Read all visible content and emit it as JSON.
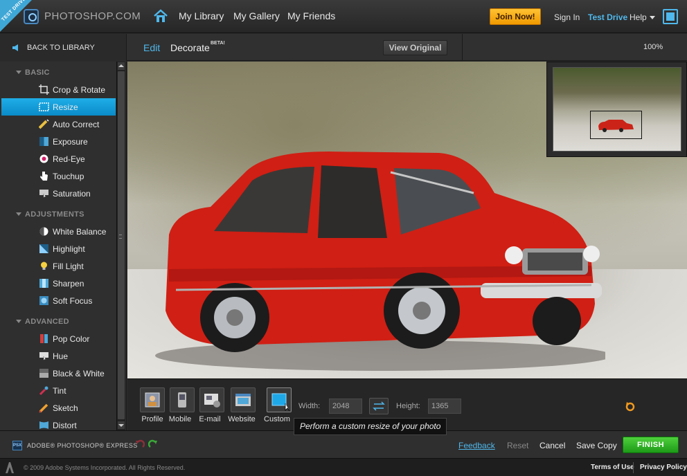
{
  "topbar": {
    "ribbon": "TEST DRIVE",
    "brand": "PHOTOSHOP.COM",
    "nav": [
      "My Library",
      "My Gallery",
      "My Friends"
    ],
    "join": "Join Now!",
    "sign_in": "Sign In",
    "test_drive": "Test Drive",
    "help": "Help",
    "accent_color": "#4fb8ec",
    "join_color": "#f5a800"
  },
  "subbar": {
    "back": "BACK TO LIBRARY",
    "edit": "Edit",
    "decorate": "Decorate",
    "beta": "BETA!",
    "view_original": "View Original",
    "zoom": "100%"
  },
  "sidebar": {
    "sections": [
      {
        "label": "BASIC",
        "items": [
          "Crop & Rotate",
          "Resize",
          "Auto Correct",
          "Exposure",
          "Red-Eye",
          "Touchup",
          "Saturation"
        ]
      },
      {
        "label": "ADJUSTMENTS",
        "items": [
          "White Balance",
          "Highlight",
          "Fill Light",
          "Sharpen",
          "Soft Focus"
        ]
      },
      {
        "label": "ADVANCED",
        "items": [
          "Pop Color",
          "Hue",
          "Black & White",
          "Tint",
          "Sketch",
          "Distort"
        ]
      }
    ],
    "active_item": "Resize",
    "active_color": "#12a0dc"
  },
  "resize": {
    "presets": [
      "Profile",
      "Mobile",
      "E-mail",
      "Website",
      "Custom"
    ],
    "selected": "Custom",
    "width_label": "Width:",
    "width_value": "2048",
    "height_label": "Height:",
    "height_value": "1365",
    "tooltip": "Perform a custom resize of your photo"
  },
  "bottombar": {
    "product": "ADOBE® PHOTOSHOP® EXPRESS",
    "product_badge": "PSX",
    "feedback": "Feedback",
    "reset": "Reset",
    "cancel": "Cancel",
    "save_copy": "Save Copy",
    "finish": "FINISH",
    "finish_color": "#33b82a"
  },
  "footer": {
    "copyright": "© 2009 Adobe Systems Incorporated. All Rights Reserved.",
    "terms": "Terms of Use",
    "privacy": "Privacy Policy"
  }
}
